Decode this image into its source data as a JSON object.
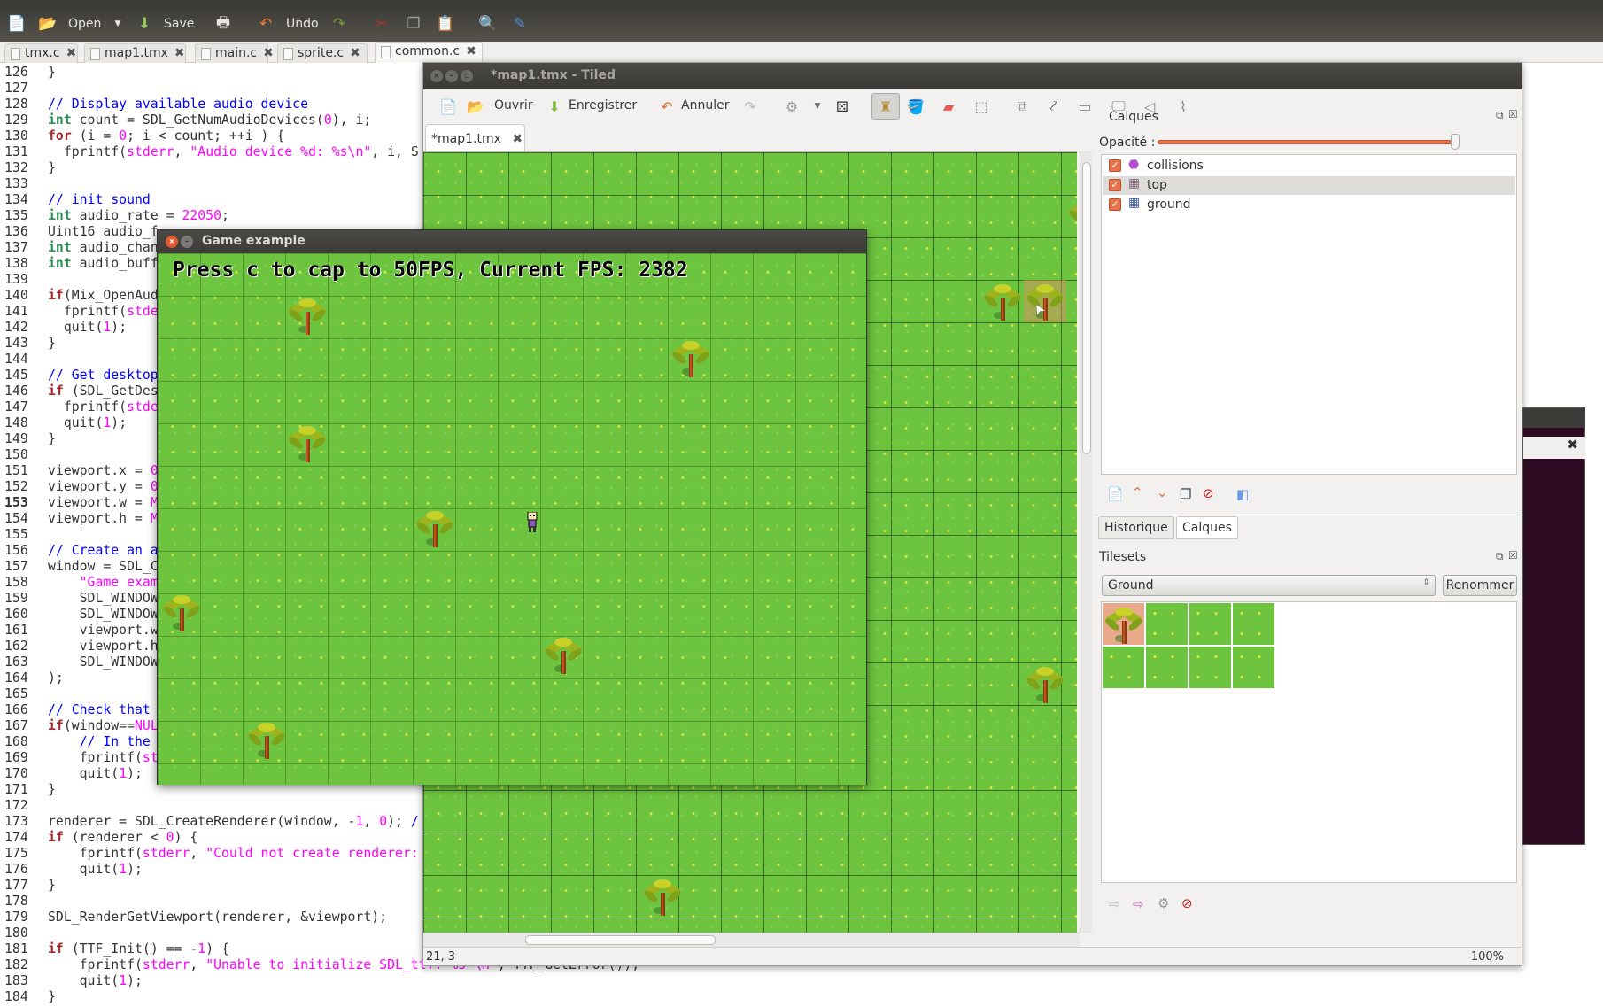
{
  "editor_toolbar": {
    "open": "Open",
    "save": "Save",
    "undo": "Undo"
  },
  "editor_tabs": [
    {
      "label": "tmx.c"
    },
    {
      "label": "map1.tmx"
    },
    {
      "label": "main.c"
    },
    {
      "label": "sprite.c"
    },
    {
      "label": "common.c",
      "active": true
    }
  ],
  "code": {
    "active_line": 153,
    "lines": [
      {
        "n": "126",
        "seg": [
          [
            "}",
            "p"
          ]
        ]
      },
      {
        "n": "127",
        "seg": []
      },
      {
        "n": "128",
        "seg": [
          [
            "// Display available audio device",
            "c"
          ]
        ]
      },
      {
        "n": "129",
        "seg": [
          [
            "int",
            "t"
          ],
          [
            " count = SDL_GetNumAudioDevices(",
            "p"
          ],
          [
            "0",
            "n"
          ],
          [
            "), i;",
            "p"
          ]
        ]
      },
      {
        "n": "130",
        "seg": [
          [
            "for",
            "k"
          ],
          [
            " (i = ",
            "p"
          ],
          [
            "0",
            "n"
          ],
          [
            "; i < count; ++i ) {",
            "p"
          ]
        ]
      },
      {
        "n": "131",
        "seg": [
          [
            "  fprintf(",
            "p"
          ],
          [
            "stderr",
            "s"
          ],
          [
            ", ",
            "p"
          ],
          [
            "\"Audio device %d: %s\\n\"",
            "s"
          ],
          [
            ", i, S",
            "p"
          ]
        ]
      },
      {
        "n": "132",
        "seg": [
          [
            "}",
            "p"
          ]
        ]
      },
      {
        "n": "133",
        "seg": []
      },
      {
        "n": "134",
        "seg": [
          [
            "// init sound",
            "c"
          ]
        ]
      },
      {
        "n": "135",
        "seg": [
          [
            "int",
            "t"
          ],
          [
            " audio_rate = ",
            "p"
          ],
          [
            "22050",
            "n"
          ],
          [
            ";",
            "p"
          ]
        ]
      },
      {
        "n": "136",
        "seg": [
          [
            "Uint16 audio_f",
            "p"
          ]
        ]
      },
      {
        "n": "137",
        "seg": [
          [
            "int",
            "t"
          ],
          [
            " audio_chan",
            "p"
          ]
        ]
      },
      {
        "n": "138",
        "seg": [
          [
            "int",
            "t"
          ],
          [
            " audio_buff",
            "p"
          ]
        ]
      },
      {
        "n": "139",
        "seg": []
      },
      {
        "n": "140",
        "seg": [
          [
            "if",
            "k"
          ],
          [
            "(Mix_OpenAud",
            "p"
          ]
        ]
      },
      {
        "n": "141",
        "seg": [
          [
            "  fprintf(",
            "p"
          ],
          [
            "stde",
            "s"
          ]
        ]
      },
      {
        "n": "142",
        "seg": [
          [
            "  quit(",
            "p"
          ],
          [
            "1",
            "n"
          ],
          [
            ");",
            "p"
          ]
        ]
      },
      {
        "n": "143",
        "seg": [
          [
            "}",
            "p"
          ]
        ]
      },
      {
        "n": "144",
        "seg": []
      },
      {
        "n": "145",
        "seg": [
          [
            "// Get desktop",
            "c"
          ]
        ]
      },
      {
        "n": "146",
        "seg": [
          [
            "if",
            "k"
          ],
          [
            " (SDL_GetDes",
            "p"
          ]
        ]
      },
      {
        "n": "147",
        "seg": [
          [
            "  fprintf(",
            "p"
          ],
          [
            "stde",
            "s"
          ]
        ]
      },
      {
        "n": "148",
        "seg": [
          [
            "  quit(",
            "p"
          ],
          [
            "1",
            "n"
          ],
          [
            ");",
            "p"
          ]
        ]
      },
      {
        "n": "149",
        "seg": [
          [
            "}",
            "p"
          ]
        ]
      },
      {
        "n": "150",
        "seg": []
      },
      {
        "n": "151",
        "seg": [
          [
            "viewport.x = ",
            "p"
          ],
          [
            "0",
            "n"
          ]
        ]
      },
      {
        "n": "152",
        "seg": [
          [
            "viewport.y = ",
            "p"
          ],
          [
            "0",
            "n"
          ]
        ]
      },
      {
        "n": "153",
        "seg": [
          [
            "viewport.w = ",
            "p"
          ],
          [
            "M",
            "s"
          ]
        ]
      },
      {
        "n": "154",
        "seg": [
          [
            "viewport.h = ",
            "p"
          ],
          [
            "M",
            "s"
          ]
        ]
      },
      {
        "n": "155",
        "seg": []
      },
      {
        "n": "156",
        "seg": [
          [
            "// Create an a",
            "c"
          ]
        ]
      },
      {
        "n": "157",
        "seg": [
          [
            "window = SDL_C",
            "p"
          ]
        ]
      },
      {
        "n": "158",
        "seg": [
          [
            "    ",
            "p"
          ],
          [
            "\"Game exam",
            "s"
          ]
        ]
      },
      {
        "n": "159",
        "seg": [
          [
            "    SDL_WINDOW",
            "p"
          ]
        ]
      },
      {
        "n": "160",
        "seg": [
          [
            "    SDL_WINDOW",
            "p"
          ]
        ]
      },
      {
        "n": "161",
        "seg": [
          [
            "    viewport.w",
            "p"
          ]
        ]
      },
      {
        "n": "162",
        "seg": [
          [
            "    viewport.h",
            "p"
          ]
        ]
      },
      {
        "n": "163",
        "seg": [
          [
            "    SDL_WINDOW",
            "p"
          ]
        ]
      },
      {
        "n": "164",
        "seg": [
          [
            ");",
            "p"
          ]
        ]
      },
      {
        "n": "165",
        "seg": []
      },
      {
        "n": "166",
        "seg": [
          [
            "// Check that",
            "c"
          ]
        ]
      },
      {
        "n": "167",
        "seg": [
          [
            "if",
            "k"
          ],
          [
            "(window==",
            "p"
          ],
          [
            "NUL",
            "s"
          ]
        ]
      },
      {
        "n": "168",
        "seg": [
          [
            "    ",
            "p"
          ],
          [
            "// In the",
            "c"
          ]
        ]
      },
      {
        "n": "169",
        "seg": [
          [
            "    fprintf(",
            "p"
          ],
          [
            "st",
            "s"
          ]
        ]
      },
      {
        "n": "170",
        "seg": [
          [
            "    quit(",
            "p"
          ],
          [
            "1",
            "n"
          ],
          [
            ");",
            "p"
          ]
        ]
      },
      {
        "n": "171",
        "seg": [
          [
            "}",
            "p"
          ]
        ]
      },
      {
        "n": "172",
        "seg": []
      },
      {
        "n": "173",
        "seg": [
          [
            "renderer = SDL_CreateRenderer(window, -",
            "p"
          ],
          [
            "1",
            "n"
          ],
          [
            ", ",
            "p"
          ],
          [
            "0",
            "n"
          ],
          [
            "); ",
            "p"
          ],
          [
            "/",
            "c"
          ]
        ]
      },
      {
        "n": "174",
        "seg": [
          [
            "if",
            "k"
          ],
          [
            " (renderer < ",
            "p"
          ],
          [
            "0",
            "n"
          ],
          [
            ") {",
            "p"
          ]
        ]
      },
      {
        "n": "175",
        "seg": [
          [
            "    fprintf(",
            "p"
          ],
          [
            "stderr",
            "s"
          ],
          [
            ", ",
            "p"
          ],
          [
            "\"Could not create renderer:",
            "s"
          ]
        ]
      },
      {
        "n": "176",
        "seg": [
          [
            "    quit(",
            "p"
          ],
          [
            "1",
            "n"
          ],
          [
            ");",
            "p"
          ]
        ]
      },
      {
        "n": "177",
        "seg": [
          [
            "}",
            "p"
          ]
        ]
      },
      {
        "n": "178",
        "seg": []
      },
      {
        "n": "179",
        "seg": [
          [
            "SDL_RenderGetViewport(renderer, &viewport);",
            "p"
          ]
        ]
      },
      {
        "n": "180",
        "seg": []
      },
      {
        "n": "181",
        "seg": [
          [
            "if",
            "k"
          ],
          [
            " (TTF_Init() == -",
            "p"
          ],
          [
            "1",
            "n"
          ],
          [
            ") {",
            "p"
          ]
        ]
      },
      {
        "n": "182",
        "seg": [
          [
            "    fprintf(",
            "p"
          ],
          [
            "stderr",
            "s"
          ],
          [
            ", ",
            "p"
          ],
          [
            "\"Unable to initialize SDL_ttf: %s \\n\"",
            "s"
          ],
          [
            ", TTF_GetError());",
            "p"
          ]
        ]
      },
      {
        "n": "183",
        "seg": [
          [
            "    quit(",
            "p"
          ],
          [
            "1",
            "n"
          ],
          [
            ");",
            "p"
          ]
        ]
      },
      {
        "n": "184",
        "seg": [
          [
            "}",
            "p"
          ]
        ]
      }
    ]
  },
  "tiled": {
    "title": "*map1.tmx - Tiled",
    "toolbar": {
      "open": "Ouvrir",
      "save": "Enregistrer",
      "undo": "Annuler"
    },
    "doc_tab": "*map1.tmx",
    "status": {
      "coords": "21, 3",
      "zoom": "100%"
    },
    "layers_panel": {
      "title": "Calques",
      "opacity_label": "Opacité :",
      "opacity": 1.0,
      "layers": [
        {
          "name": "collisions",
          "type": "object",
          "visible": true
        },
        {
          "name": "top",
          "type": "tile",
          "visible": true,
          "selected": true
        },
        {
          "name": "ground",
          "type": "tile",
          "visible": true
        }
      ]
    },
    "dock_tabs": [
      {
        "label": "Historique"
      },
      {
        "label": "Calques",
        "active": true
      }
    ],
    "tilesets_panel": {
      "title": "Tilesets",
      "selected": "Ground",
      "rename": "Renommer"
    }
  },
  "game": {
    "title": "Game example",
    "overlay": "Press c to cap to 50FPS, Current FPS: 2382"
  },
  "colors": {
    "grass": "#6cc43f",
    "accent": "#e8734a",
    "title_bar": "#3c3b37",
    "terminal": "#2c0a22"
  }
}
